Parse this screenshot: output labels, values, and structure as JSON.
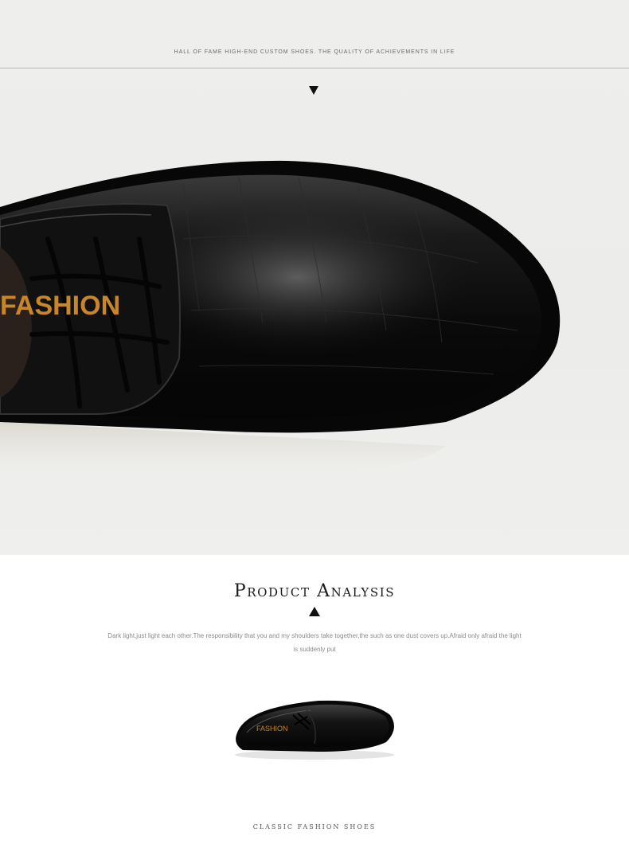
{
  "hero": {
    "tagline": "HALL OF FAME HIGH-END CUSTOM SHOES. THE QUALITY OF ACHIEVEMENTS IN LIFE",
    "shoe_brand_mark": "FASHION"
  },
  "analysis": {
    "title": "Product Analysis",
    "description": "Dark light,just light each other.The responsibility that you and my shoulders take together,the such as one dust covers up.Afraid only afraid the light is suddenly put"
  },
  "product": {
    "brand_label": "FASHION"
  },
  "footer": {
    "label": "CLASSIC FASHION SHOES"
  },
  "colors": {
    "leather": "#0d0d0d",
    "brand_gold": "#c8862a",
    "background_gray": "#eeeeec"
  },
  "icons": [
    "down-triangle-icon",
    "up-triangle-icon"
  ]
}
